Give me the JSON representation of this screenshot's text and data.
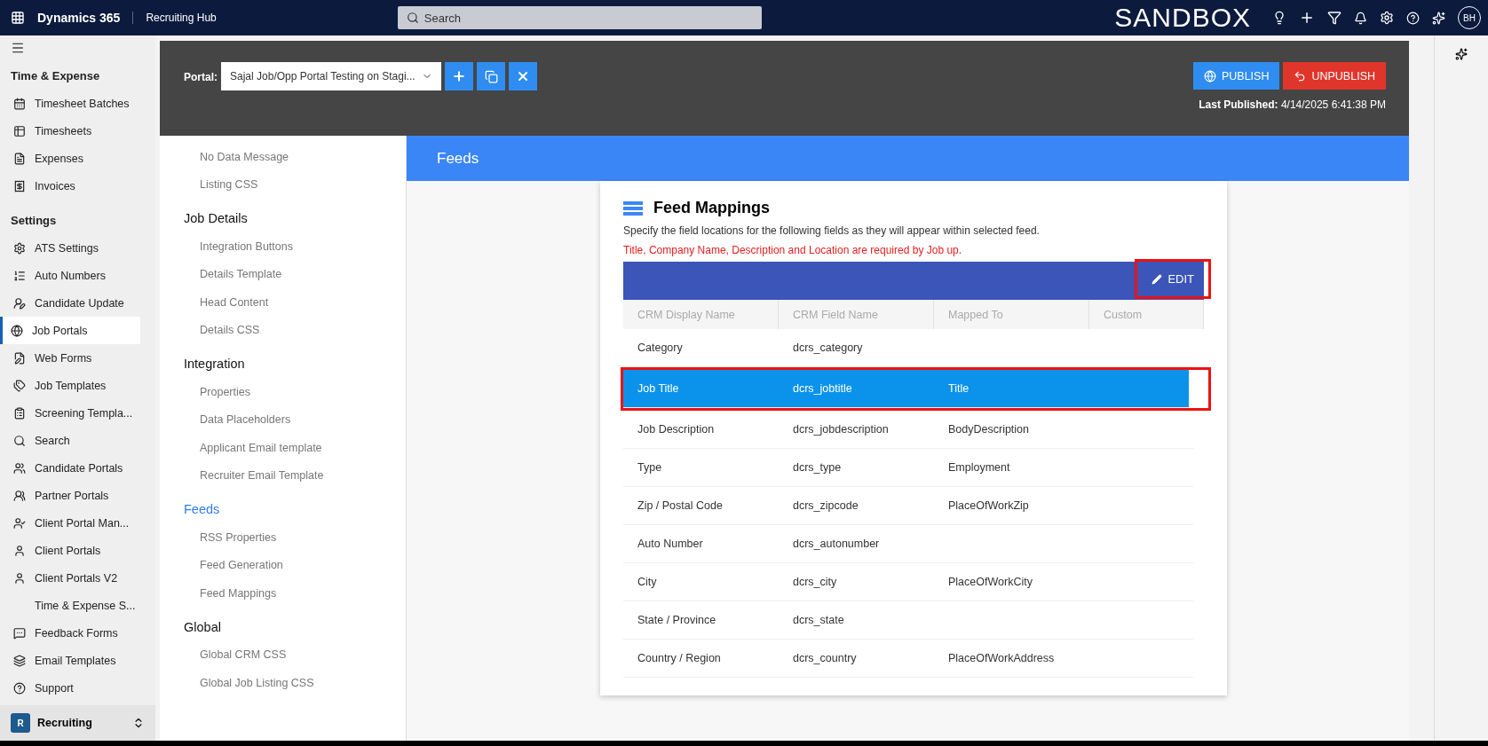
{
  "topbar": {
    "app": "Dynamics 365",
    "area": "Recruiting Hub",
    "search_placeholder": "Search",
    "environment": "SANDBOX",
    "avatar": "BH"
  },
  "sidebar": {
    "groups": [
      {
        "title": "Time & Expense",
        "items": [
          {
            "label": "Timesheet Batches",
            "selected": false
          },
          {
            "label": "Timesheets",
            "selected": false
          },
          {
            "label": "Expenses",
            "selected": false
          },
          {
            "label": "Invoices",
            "selected": false
          }
        ]
      },
      {
        "title": "Settings",
        "items": [
          {
            "label": "ATS Settings",
            "selected": false
          },
          {
            "label": "Auto Numbers",
            "selected": false
          },
          {
            "label": "Candidate Update",
            "selected": false
          },
          {
            "label": "Job Portals",
            "selected": true
          },
          {
            "label": "Web Forms",
            "selected": false
          },
          {
            "label": "Job Templates",
            "selected": false
          },
          {
            "label": "Screening Templa...",
            "selected": false
          },
          {
            "label": "Search",
            "selected": false
          },
          {
            "label": "Candidate Portals",
            "selected": false
          },
          {
            "label": "Partner Portals",
            "selected": false
          },
          {
            "label": "Client Portal Man...",
            "selected": false
          },
          {
            "label": "Client Portals",
            "selected": false
          },
          {
            "label": "Client Portals V2",
            "selected": false
          },
          {
            "label": "Time & Expense S...",
            "selected": false
          },
          {
            "label": "Feedback Forms",
            "selected": false
          },
          {
            "label": "Email Templates",
            "selected": false
          },
          {
            "label": "Support",
            "selected": false
          }
        ]
      }
    ],
    "area_badge": "R",
    "area_name": "Recruiting"
  },
  "portal_bar": {
    "label": "Portal:",
    "portal": "Sajal Job/Opp Portal Testing on Stagi...",
    "publish": "PUBLISH",
    "unpublish": "UNPUBLISH",
    "last_published_label": "Last Published:",
    "last_published": "4/14/2025 6:41:38 PM"
  },
  "nav": [
    {
      "items": [
        "No Data Message",
        "Listing CSS"
      ]
    },
    {
      "title": "Job Details",
      "active": false,
      "items": [
        "Integration Buttons",
        "Details Template",
        "Head Content",
        "Details CSS"
      ]
    },
    {
      "title": "Integration",
      "active": false,
      "items": [
        "Properties",
        "Data Placeholders",
        "Applicant Email template",
        "Recruiter Email Template"
      ]
    },
    {
      "title": "Feeds",
      "active": true,
      "items": [
        "RSS Properties",
        "Feed Generation",
        "Feed Mappings"
      ]
    },
    {
      "title": "Global",
      "active": false,
      "items": [
        "Global CRM CSS",
        "Global Job Listing CSS"
      ]
    }
  ],
  "section_title": "Feeds",
  "card": {
    "title": "Feed Mappings",
    "description": "Specify the field locations for the following fields as they will appear within selected feed.",
    "warning": "Title, Company Name, Description and Location are required by Job up.",
    "edit": "EDIT",
    "columns": [
      "CRM Display Name",
      "CRM Field Name",
      "Mapped To",
      "Custom"
    ],
    "rows": [
      {
        "cells": [
          "Category",
          "dcrs_category",
          ""
        ],
        "selected": false
      },
      {
        "cells": [
          "Job Title",
          "dcrs_jobtitle",
          "Title"
        ],
        "selected": true
      },
      {
        "cells": [
          "Job Description",
          "dcrs_jobdescription",
          "BodyDescription"
        ],
        "selected": false
      },
      {
        "cells": [
          "Type",
          "dcrs_type",
          "Employment"
        ],
        "selected": false
      },
      {
        "cells": [
          "Zip / Postal Code",
          "dcrs_zipcode",
          "PlaceOfWorkZip"
        ],
        "selected": false
      },
      {
        "cells": [
          "Auto Number",
          "dcrs_autonumber",
          ""
        ],
        "selected": false
      },
      {
        "cells": [
          "City",
          "dcrs_city",
          "PlaceOfWorkCity"
        ],
        "selected": false
      },
      {
        "cells": [
          "State / Province",
          "dcrs_state",
          ""
        ],
        "selected": false
      },
      {
        "cells": [
          "Country / Region",
          "dcrs_country",
          "PlaceOfWorkAddress"
        ],
        "selected": false
      }
    ]
  }
}
